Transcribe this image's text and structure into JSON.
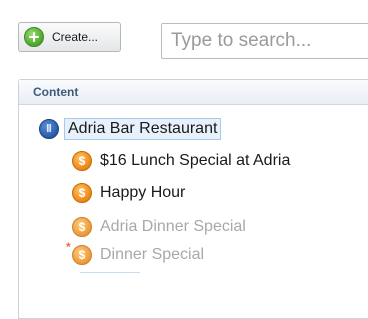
{
  "toolbar": {
    "create_label": "Create...",
    "search_placeholder": "Type to search..."
  },
  "panel": {
    "title": "Content"
  },
  "tree": {
    "root": {
      "label": "Adria Bar Restaurant",
      "icon": "restaurant-icon",
      "selected": true
    },
    "items": [
      {
        "label": "$16 Lunch Special at Adria",
        "icon": "dollar-icon",
        "state": "active"
      },
      {
        "label": "Happy Hour",
        "icon": "dollar-icon",
        "state": "active"
      },
      {
        "label": "Adria Dinner Special",
        "icon": "dollar-icon",
        "state": "inactive"
      },
      {
        "label": "Dinner Special",
        "icon": "dollar-icon",
        "state": "inactive",
        "new": true
      }
    ]
  },
  "colors": {
    "accent": "#3d5a7a",
    "selection": "#e7f1fb",
    "deal_icon": "#f0921f",
    "muted_text": "#a8a8a8"
  }
}
